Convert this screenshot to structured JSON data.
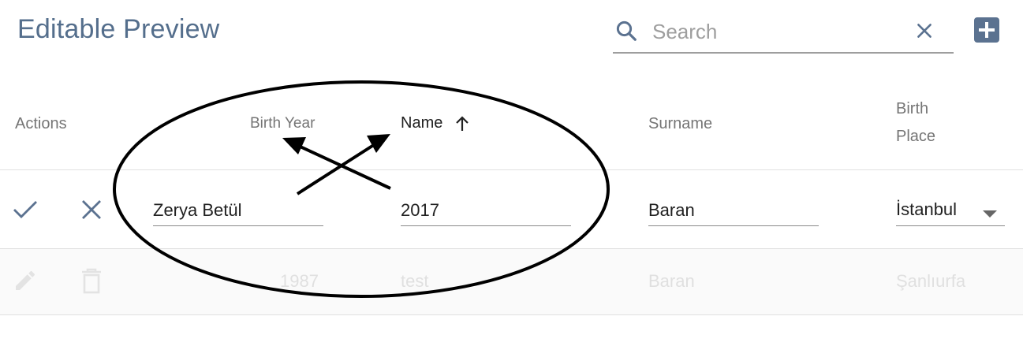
{
  "header": {
    "title": "Editable Preview",
    "search_placeholder": "Search",
    "search_value": ""
  },
  "table": {
    "columns": {
      "actions": "Actions",
      "birth_year": "Birth Year",
      "name": "Name",
      "surname": "Surname",
      "birth_place_line1": "Birth",
      "birth_place_line2": "Place"
    },
    "sort": {
      "column": "name",
      "direction": "ascending"
    },
    "edit_row": {
      "birth_year_field": "Zerya Betül",
      "name_field": "2017",
      "surname_field": "Baran",
      "birth_place": "İstanbul"
    },
    "rows": [
      {
        "birth_year": "1987",
        "name": "test",
        "surname": "Baran",
        "birth_place": "Şanlıurfa"
      }
    ]
  },
  "icons": {
    "search": "search-icon",
    "clear": "close-icon",
    "add": "add-box-icon",
    "save": "check-icon",
    "cancel": "close-icon",
    "edit": "pencil-icon",
    "delete": "trash-icon",
    "sort": "arrow-up-icon",
    "dropdown": "caret-down-icon"
  },
  "colors": {
    "title": "#546e8c",
    "accent": "#5b7290",
    "disabled_text": "#e0e0e0"
  }
}
